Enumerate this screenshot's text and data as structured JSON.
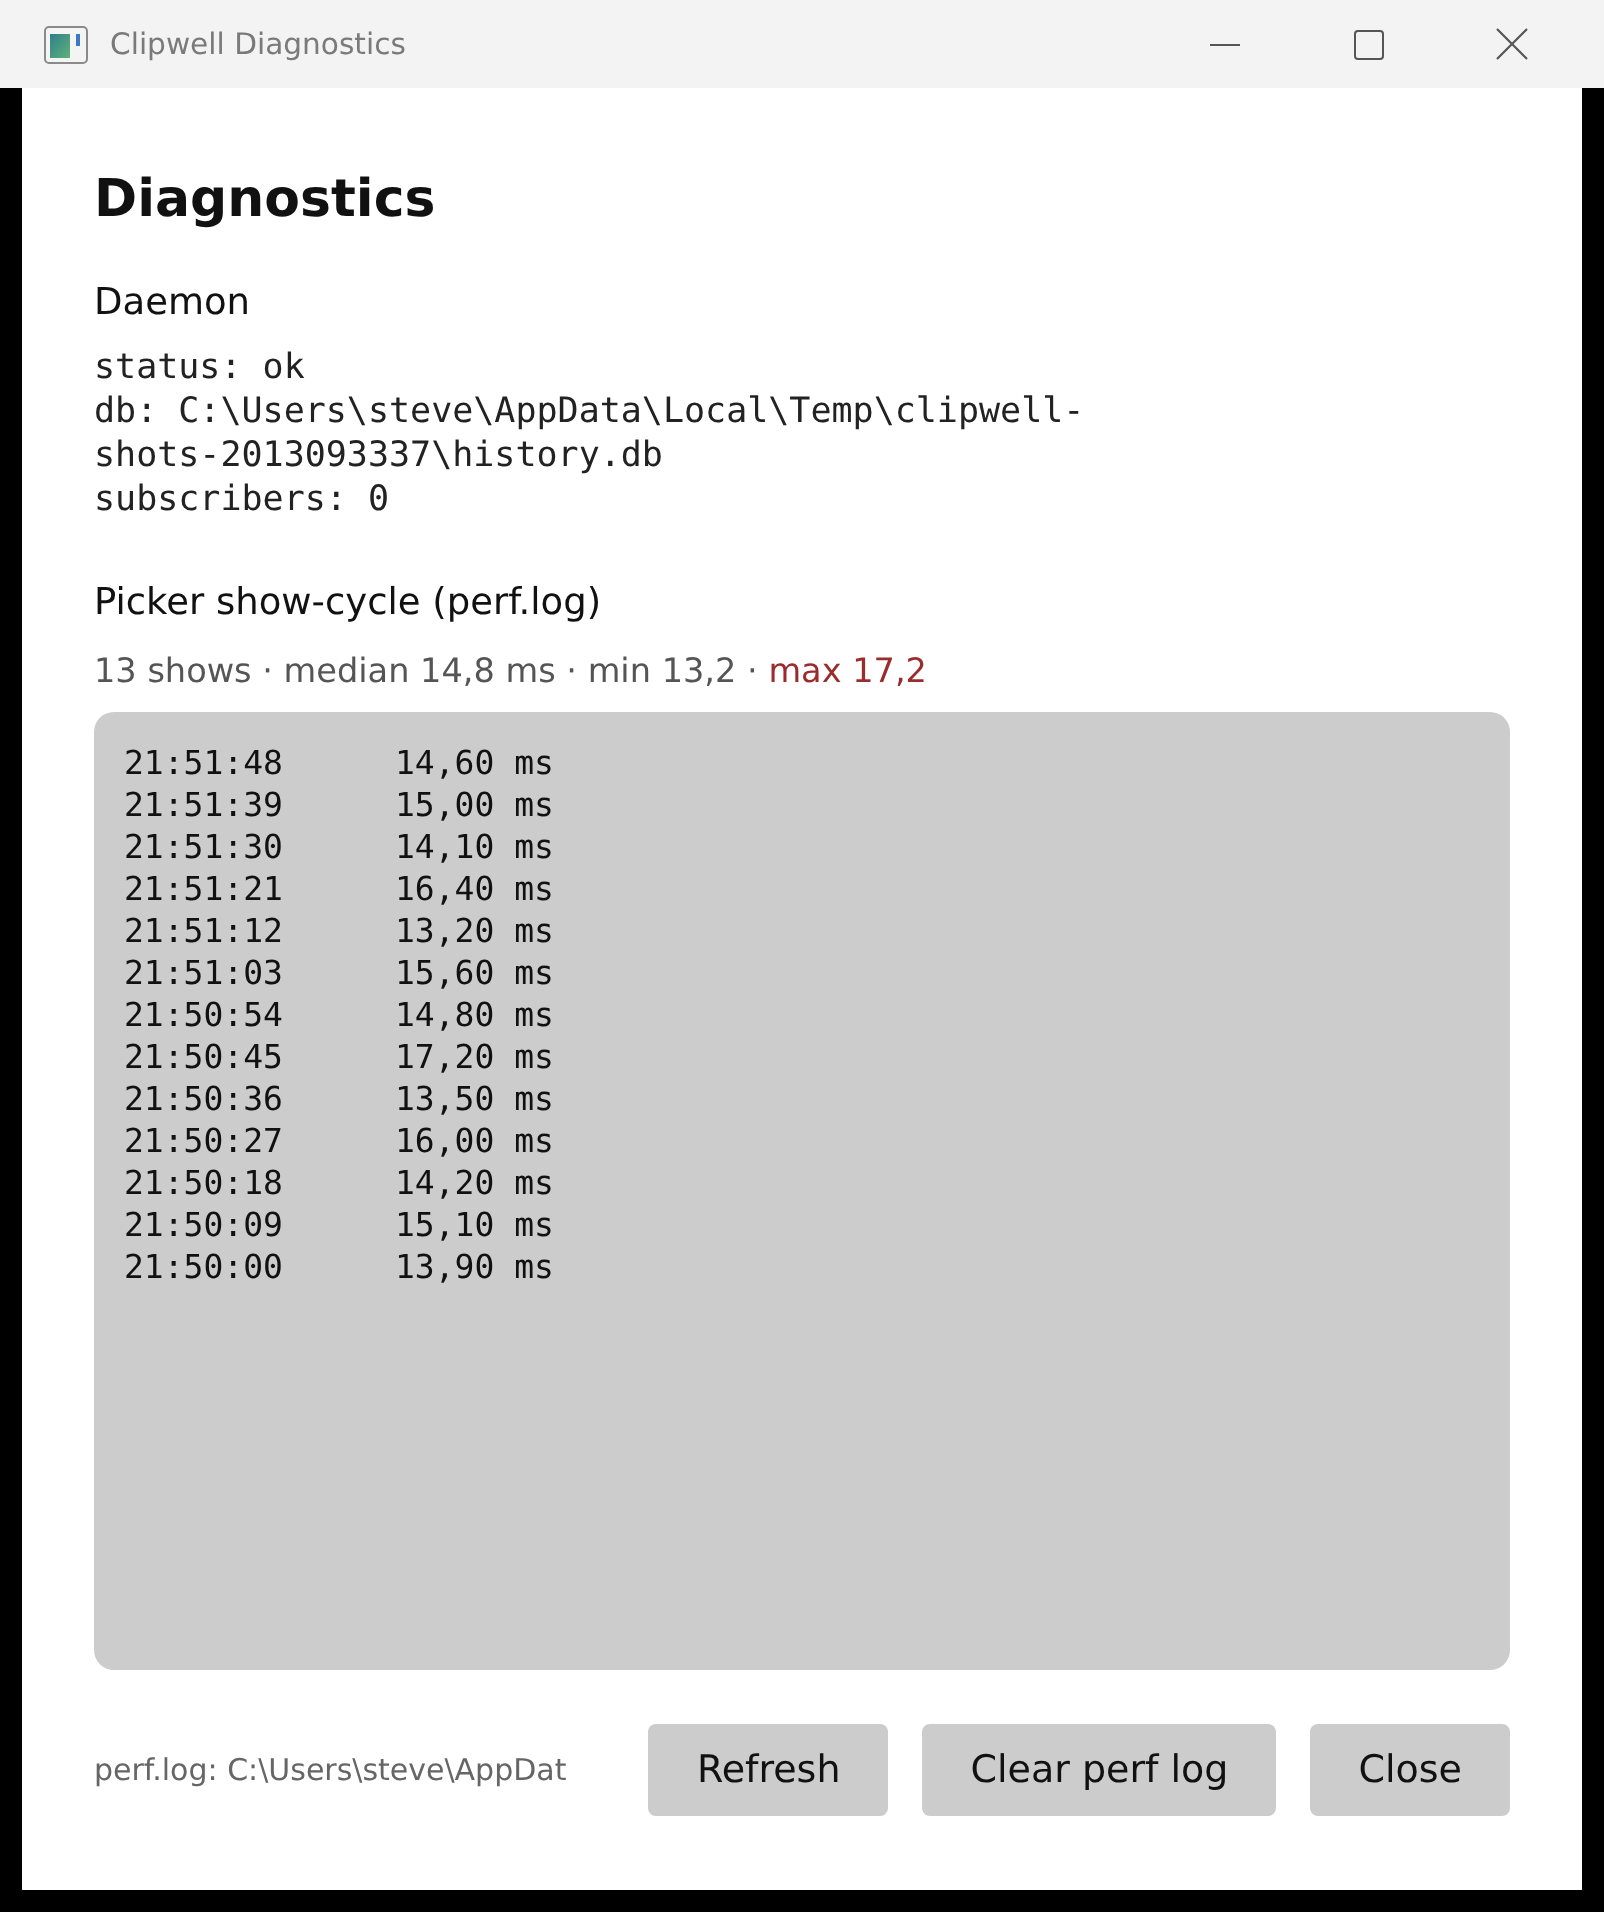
{
  "window": {
    "title": "Clipwell Diagnostics"
  },
  "heading": "Diagnostics",
  "daemon": {
    "title": "Daemon",
    "lines": [
      "status: ok",
      "db: C:\\Users\\steve\\AppData\\Local\\Temp\\clipwell-shots-2013093337\\history.db",
      "subscribers: 0"
    ]
  },
  "perf": {
    "title": "Picker show-cycle (perf.log)",
    "stats": [
      {
        "text": "13 shows · median 14,8 ms · min 13,2 ·",
        "kind": "normal"
      },
      {
        "text": "max 17,2",
        "kind": "alert"
      }
    ],
    "log": [
      {
        "time": "21:51:48",
        "duration": "14,60 ms"
      },
      {
        "time": "21:51:39",
        "duration": "15,00 ms"
      },
      {
        "time": "21:51:30",
        "duration": "14,10 ms"
      },
      {
        "time": "21:51:21",
        "duration": "16,40 ms"
      },
      {
        "time": "21:51:12",
        "duration": "13,20 ms"
      },
      {
        "time": "21:51:03",
        "duration": "15,60 ms"
      },
      {
        "time": "21:50:54",
        "duration": "14,80 ms"
      },
      {
        "time": "21:50:45",
        "duration": "17,20 ms"
      },
      {
        "time": "21:50:36",
        "duration": "13,50 ms"
      },
      {
        "time": "21:50:27",
        "duration": "16,00 ms"
      },
      {
        "time": "21:50:18",
        "duration": "14,20 ms"
      },
      {
        "time": "21:50:09",
        "duration": "15,10 ms"
      },
      {
        "time": "21:50:00",
        "duration": "13,90 ms"
      }
    ]
  },
  "footer": {
    "path": "perf.log: C:\\Users\\steve\\AppDat",
    "buttons": [
      "Refresh",
      "Clear perf log",
      "Close"
    ]
  }
}
